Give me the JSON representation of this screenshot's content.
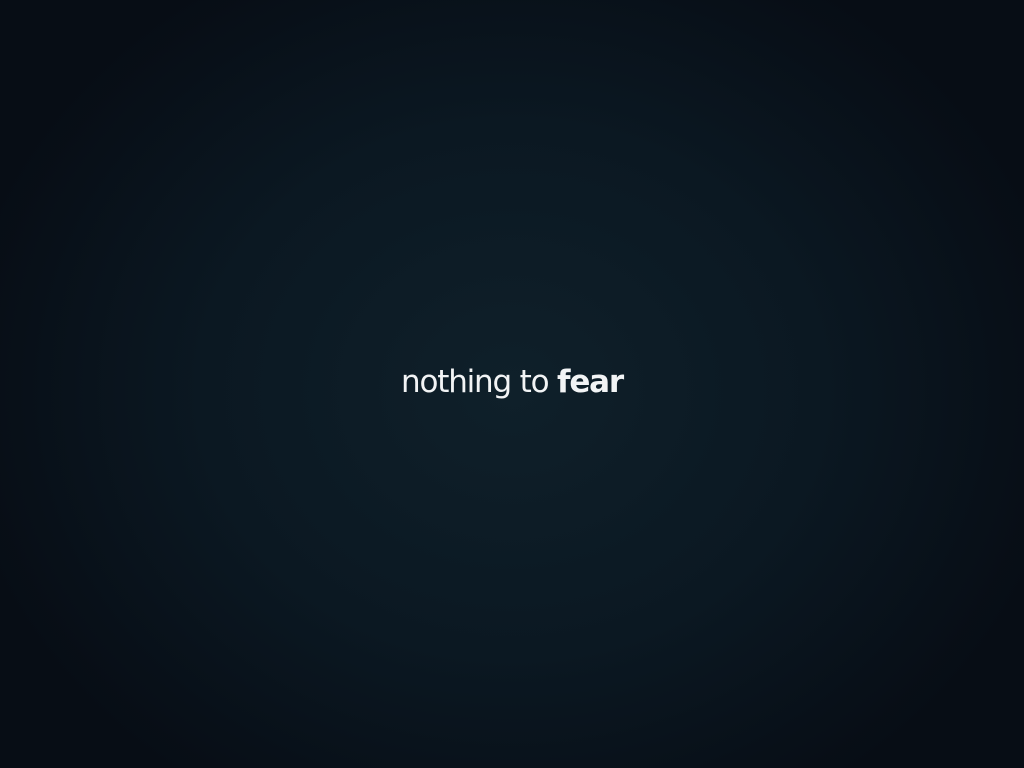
{
  "slide": {
    "text_regular": "nothing to",
    "text_bold": "fear"
  },
  "colors": {
    "background_center": "#0f202a",
    "background_mid": "#0b1822",
    "background_edge": "#070d15",
    "text": "#f2f4f5"
  }
}
